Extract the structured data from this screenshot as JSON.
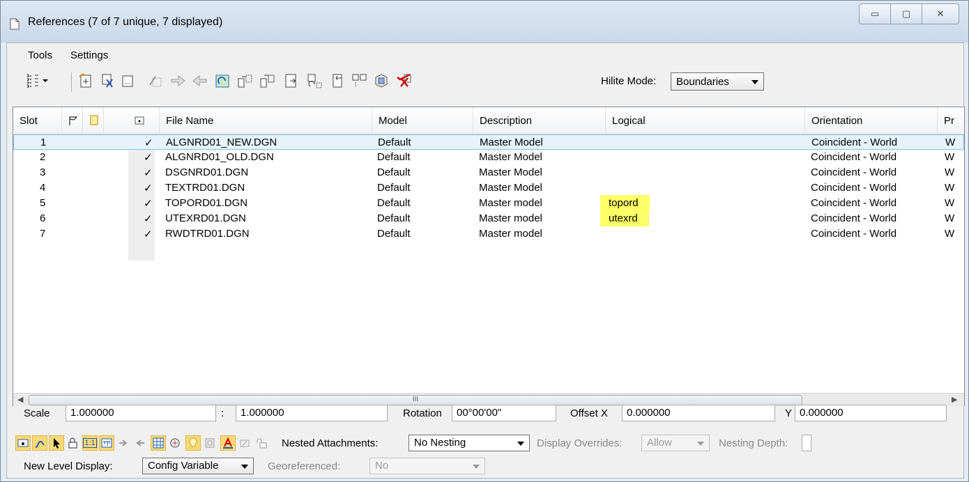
{
  "window": {
    "title": "References (7 of 7 unique, 7 displayed)",
    "minimize_label": "▭",
    "maximize_label": "▢",
    "close_label": "✕"
  },
  "menu": {
    "tools": "Tools",
    "settings": "Settings"
  },
  "toolbar": {
    "hilite_label": "Hilite Mode:",
    "hilite_value": "Boundaries"
  },
  "grid": {
    "columns": [
      "Slot",
      "File Name",
      "Model",
      "Description",
      "Logical",
      "Orientation",
      "Pr"
    ],
    "rows": [
      {
        "slot": "1",
        "check": "✓",
        "file": "ALGNRD01_NEW.DGN",
        "model": "Default",
        "desc": "Master Model",
        "logical": "",
        "orient": "Coincident - World",
        "extra": "W"
      },
      {
        "slot": "2",
        "check": "✓",
        "file": "ALGNRD01_OLD.DGN",
        "model": "Default",
        "desc": "Master Model",
        "logical": "",
        "orient": "Coincident - World",
        "extra": "W"
      },
      {
        "slot": "3",
        "check": "✓",
        "file": "DSGNRD01.DGN",
        "model": "Default",
        "desc": "Master Model",
        "logical": "",
        "orient": "Coincident - World",
        "extra": "W"
      },
      {
        "slot": "4",
        "check": "✓",
        "file": "TEXTRD01.DGN",
        "model": "Default",
        "desc": "Master Model",
        "logical": "",
        "orient": "Coincident - World",
        "extra": "W"
      },
      {
        "slot": "5",
        "check": "✓",
        "file": "TOPORD01.DGN",
        "model": "Default",
        "desc": "Master model",
        "logical": "topord",
        "orient": "Coincident - World",
        "extra": "W"
      },
      {
        "slot": "6",
        "check": "✓",
        "file": "UTEXRD01.DGN",
        "model": "Default",
        "desc": "Master model",
        "logical": "utexrd",
        "orient": "Coincident - World",
        "extra": "W"
      },
      {
        "slot": "7",
        "check": "✓",
        "file": "RWDTRD01.DGN",
        "model": "Default",
        "desc": "Master model",
        "logical": "",
        "orient": "Coincident - World",
        "extra": "W"
      }
    ],
    "scroll_grip": "III"
  },
  "props": {
    "scale_label": "Scale",
    "scale_value": "1.000000",
    "colon": ":",
    "scale_value2": "1.000000",
    "rotation_label": "Rotation",
    "rotation_value": "00°00'00\"",
    "offset_x_label": "Offset X",
    "offset_x_value": "0.000000",
    "y_label": "Y",
    "offset_y_value": "0.000000",
    "nested_label": "Nested Attachments:",
    "nested_value": "No Nesting",
    "display_overrides_label": "Display Overrides:",
    "display_overrides_value": "Allow",
    "nesting_depth_label": "Nesting Depth:",
    "new_level_label": "New Level Display:",
    "new_level_value": "Config Variable",
    "georef_label": "Georeferenced:",
    "georef_value": "No",
    "one_to_one": "1:1"
  },
  "colors": {
    "highlight": "#ffff66",
    "selected_row": "#e6f3fb",
    "active_button": "#f8d979"
  }
}
